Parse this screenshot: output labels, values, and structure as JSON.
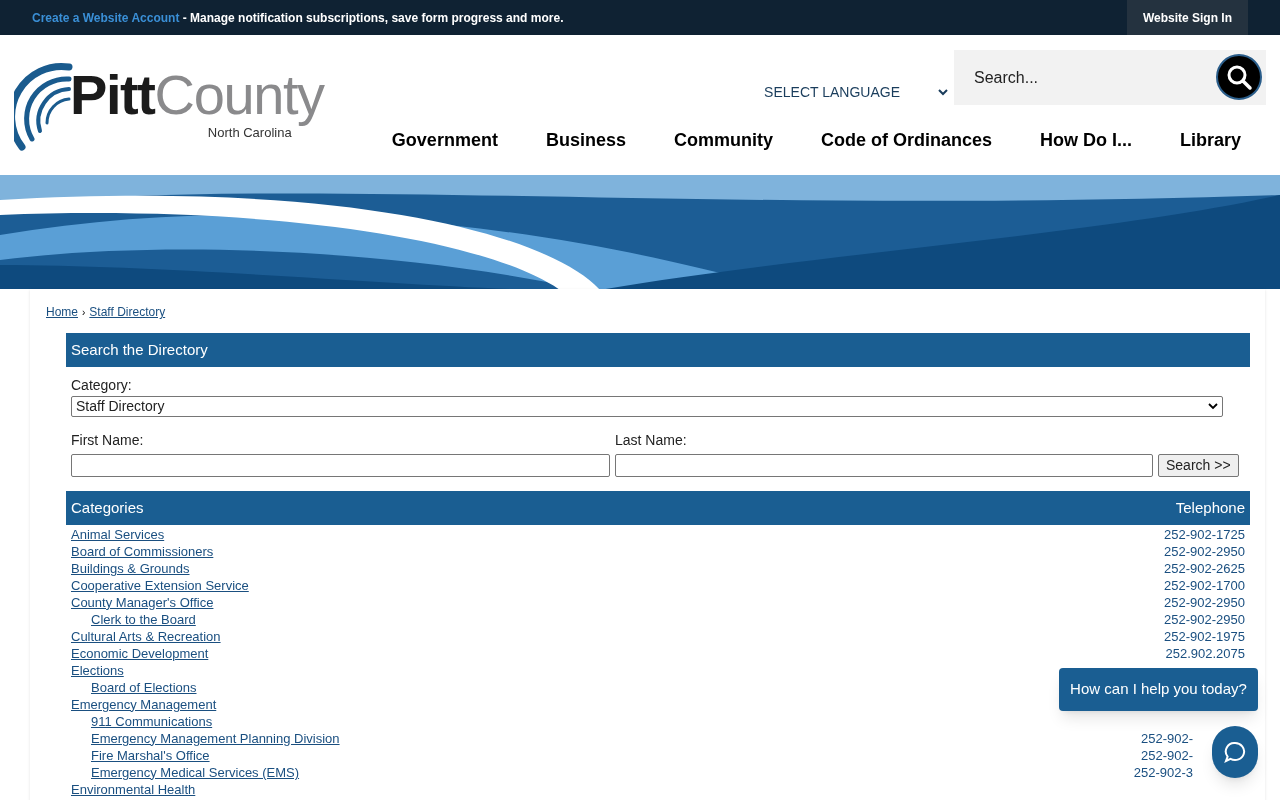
{
  "top_bar": {
    "account_link": "Create a Website Account",
    "account_text": "- Manage notification subscriptions, save form progress and more.",
    "sign_in": "Website Sign In"
  },
  "logo": {
    "name_bold": "Pitt",
    "name_light": "County",
    "subtitle": "North Carolina"
  },
  "language": {
    "label": "SELECT LANGUAGE"
  },
  "search": {
    "placeholder": "Search..."
  },
  "nav": [
    "Government",
    "Business",
    "Community",
    "Code of Ordinances",
    "How Do I...",
    "Library"
  ],
  "breadcrumb": [
    "Home",
    "Staff Directory"
  ],
  "breadcrumb_separator": "›",
  "directory_search": {
    "title": "Search the Directory",
    "category_label": "Category:",
    "category_value": "Staff Directory",
    "first_name_label": "First Name:",
    "last_name_label": "Last Name:",
    "button": "Search >>"
  },
  "table": {
    "columns": [
      "Categories",
      "Telephone"
    ],
    "rows": [
      {
        "name": "Animal Services",
        "phone": "252-902-1725"
      },
      {
        "name": "Board of Commissioners",
        "phone": "252-902-2950"
      },
      {
        "name": "Buildings & Grounds",
        "phone": "252-902-2625"
      },
      {
        "name": "Cooperative Extension Service",
        "phone": "252-902-1700"
      },
      {
        "name": "County Manager's Office",
        "phone": "252-902-2950",
        "children": [
          {
            "name": "Clerk to the Board",
            "phone": "252-902-2950"
          }
        ]
      },
      {
        "name": "Cultural Arts & Recreation",
        "phone": "252-902-1975"
      },
      {
        "name": "Economic Development",
        "phone": "252.902.2075"
      },
      {
        "name": "Elections",
        "children": [
          {
            "name": "Board of Elections"
          }
        ]
      },
      {
        "name": "Emergency Management",
        "children": [
          {
            "name": "911 Communications"
          },
          {
            "name": "Emergency Management Planning Division",
            "phone": "252-902-"
          },
          {
            "name": "Fire Marshal's Office",
            "phone": "252-902-"
          },
          {
            "name": "Emergency Medical Services (EMS)",
            "phone": "252-902-3"
          }
        ]
      },
      {
        "name": "Environmental Health"
      }
    ]
  },
  "chat": {
    "prompt": "How can I help you today?"
  }
}
